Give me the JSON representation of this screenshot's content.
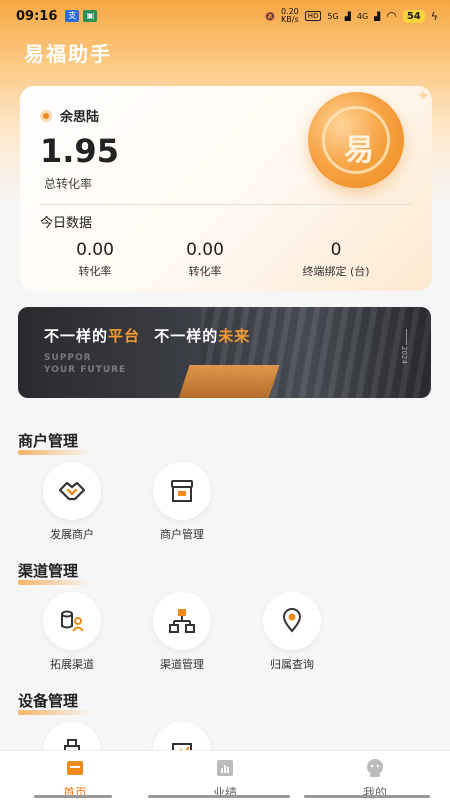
{
  "status_bar": {
    "time": "09:16",
    "net_speed_value": "0.20",
    "net_speed_unit": "KB/s",
    "signal_1": "5G",
    "signal_2": "4G",
    "battery": "54"
  },
  "app": {
    "title": "易福助手"
  },
  "stats": {
    "user_name": "余思陆",
    "conversion_value": "1.95",
    "conversion_label": "总转化率",
    "today_title": "今日数据",
    "metrics": [
      {
        "value": "0.00",
        "label": "转化率"
      },
      {
        "value": "0.00",
        "label": "转化率"
      },
      {
        "value": "0",
        "label": "终端绑定 (台)"
      }
    ]
  },
  "banner": {
    "line_a": "不一样的",
    "line_a_hl": "平台",
    "line_b": "不一样的",
    "line_b_hl": "未来",
    "en_1": "SUPPOR",
    "en_2": "YOUR FUTURE",
    "year": "2024"
  },
  "sections": [
    {
      "title": "商户管理",
      "items": [
        {
          "label": "发展商户",
          "icon": "handshake-icon"
        },
        {
          "label": "商户管理",
          "icon": "store-icon"
        }
      ]
    },
    {
      "title": "渠道管理",
      "items": [
        {
          "label": "拓展渠道",
          "icon": "channel-expand-icon"
        },
        {
          "label": "渠道管理",
          "icon": "network-icon"
        },
        {
          "label": "归属查询",
          "icon": "location-pin-icon"
        }
      ]
    },
    {
      "title": "设备管理",
      "items": [
        {
          "label": "",
          "icon": "device-icon"
        },
        {
          "label": "",
          "icon": "chart-icon"
        }
      ]
    }
  ],
  "tabs": [
    {
      "label": "首页",
      "icon": "home-icon",
      "active": true
    },
    {
      "label": "业绩",
      "icon": "bar-chart-icon",
      "active": false
    },
    {
      "label": "我的",
      "icon": "profile-icon",
      "active": false
    }
  ],
  "colors": {
    "accent": "#f07c1a",
    "brand_orange": "#f7a744"
  }
}
